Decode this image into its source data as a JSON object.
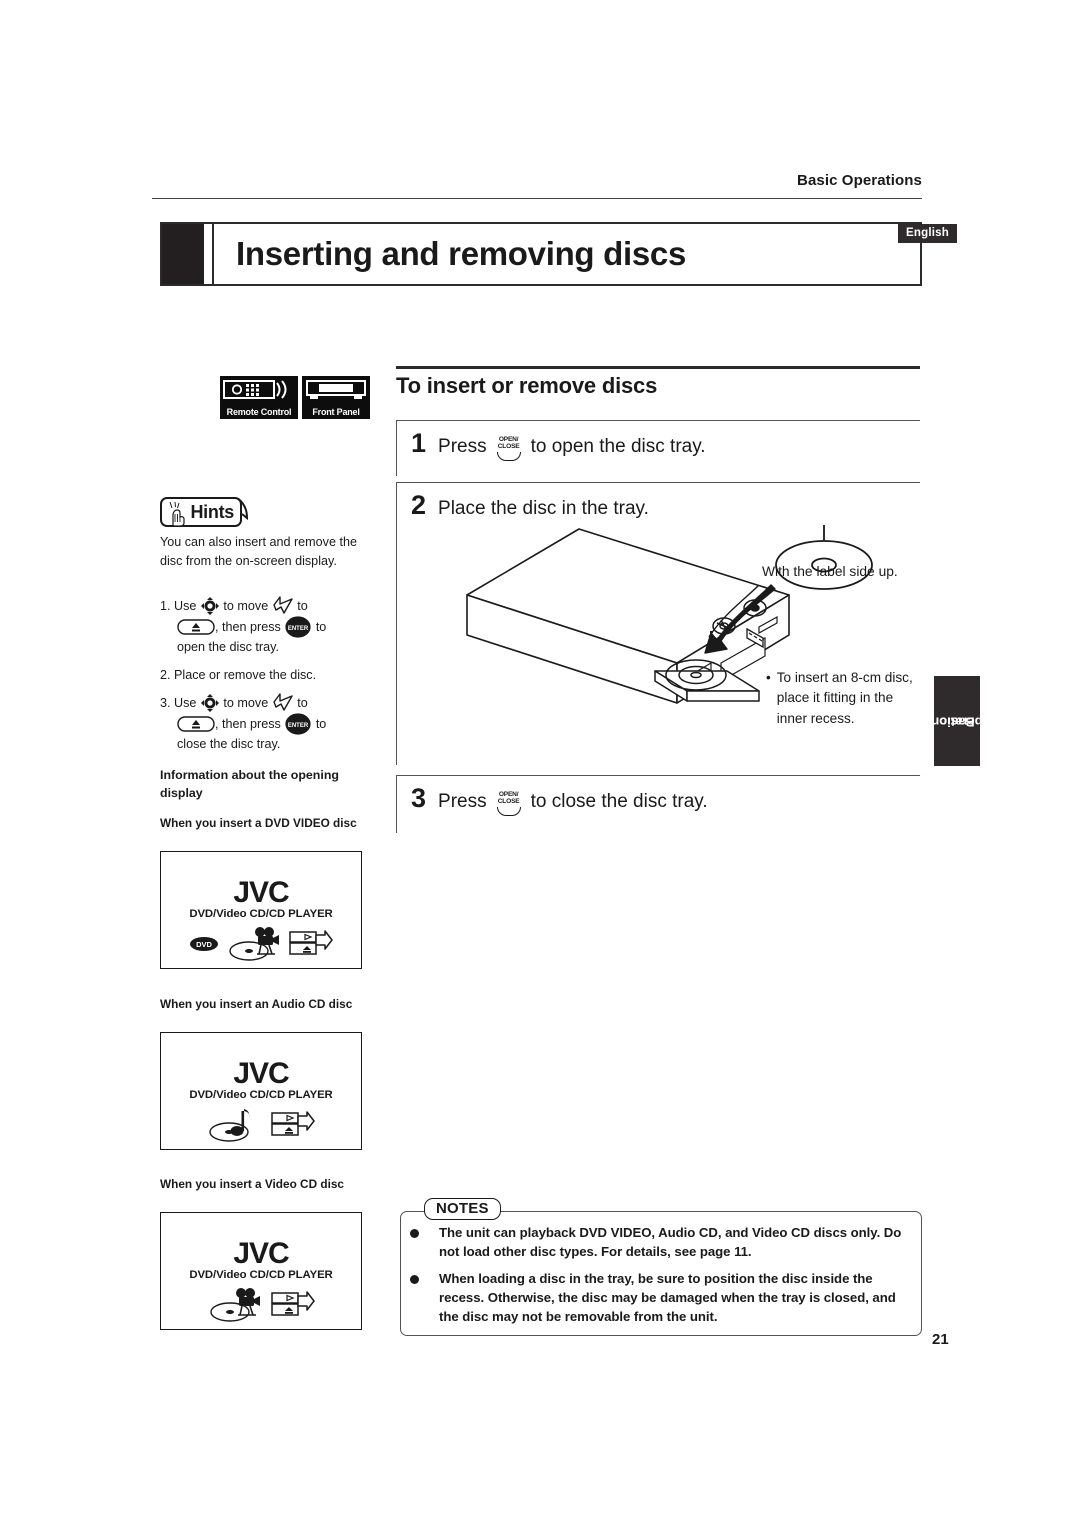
{
  "header": {
    "running_head": "Basic Operations",
    "title": "Inserting and removing discs",
    "language_tab": "English"
  },
  "badges": {
    "remote_control": "Remote Control",
    "front_panel": "Front Panel"
  },
  "section": {
    "title": "To insert or remove discs",
    "steps": [
      {
        "num": "1",
        "before": "Press",
        "button_line1": "OPEN/",
        "button_line2": "CLOSE",
        "after": "to open the disc tray."
      },
      {
        "num": "2",
        "before": "",
        "button_line1": "",
        "button_line2": "",
        "after": "Place the disc in the tray."
      },
      {
        "num": "3",
        "before": "Press",
        "button_line1": "OPEN/",
        "button_line2": "CLOSE",
        "after": "to close the disc tray."
      }
    ]
  },
  "illustration": {
    "caption": "With the label side up.",
    "bullet_marker": "•",
    "bullet": "To insert an 8-cm disc, place it fitting in the inner recess."
  },
  "side_tab": {
    "line1": "Basic",
    "line2": "operations"
  },
  "hints": {
    "label": "Hints",
    "intro": "You can also insert and remove the disc from the on-screen display.",
    "steps": [
      {
        "num": "1.",
        "seg1": "Use",
        "icon1": "joystick-cursor-icon",
        "seg2": "to move",
        "icon2": "arrow-cursor-icon",
        "seg3": "to",
        "icon3": "eject-button-icon",
        "seg4": ", then press",
        "icon4": "enter-button-icon",
        "seg5": "to",
        "seg6": "open the disc tray."
      },
      {
        "num": "2.",
        "seg1": "Place or remove the disc.",
        "seg2": "",
        "seg3": "",
        "seg4": "",
        "seg5": "",
        "seg6": ""
      },
      {
        "num": "3.",
        "seg1": "Use",
        "icon1": "joystick-cursor-icon",
        "seg2": "to move",
        "icon2": "arrow-cursor-icon",
        "seg3": "to",
        "icon3": "eject-button-icon",
        "seg4": ", then press",
        "icon4": "enter-button-icon",
        "seg5": "to",
        "seg6": "close the disc tray."
      }
    ],
    "enter_label": "ENTER"
  },
  "opening_display": {
    "heading": "Information about the opening display",
    "items": [
      {
        "label": "When you insert a DVD VIDEO disc",
        "brand": "JVC",
        "sub": "DVD/Video CD/CD PLAYER",
        "icons": [
          "dvd-logo-icon",
          "disc-film-camera-icon",
          "play-eject-panel-icon"
        ]
      },
      {
        "label": "When you insert an Audio CD disc",
        "brand": "JVC",
        "sub": "DVD/Video CD/CD PLAYER",
        "icons": [
          "disc-music-note-icon",
          "play-eject-panel-icon"
        ]
      },
      {
        "label": "When you insert a Video CD disc",
        "brand": "JVC",
        "sub": "DVD/Video CD/CD PLAYER",
        "icons": [
          "disc-film-camera-icon",
          "play-eject-panel-icon"
        ]
      }
    ]
  },
  "notes": {
    "title": "NOTES",
    "items": [
      "The unit can playback DVD VIDEO, Audio CD, and Video CD discs only.  Do not load other disc types. For details, see page 11.",
      "When loading a disc in the tray, be sure to position the disc inside the recess. Otherwise, the disc may be damaged when the tray is closed, and the disc may not be removable from the unit."
    ]
  },
  "page_number": "21",
  "colors": {
    "ink": "#1a1a1a",
    "rule": "#5a4f57",
    "tab_bg": "#2f2b2c"
  }
}
